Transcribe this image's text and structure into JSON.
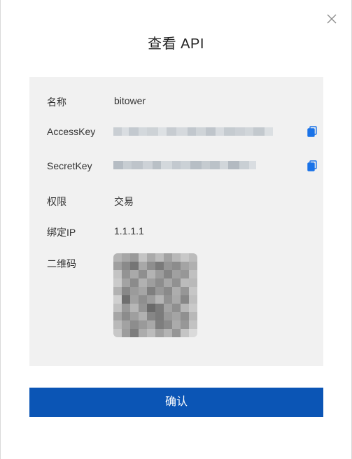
{
  "dialog": {
    "title": "查看 API",
    "close_icon": "close-icon"
  },
  "details": {
    "name_label": "名称",
    "name_value": "bitower",
    "access_key_label": "AccessKey",
    "access_key_value_masked": true,
    "secret_key_label": "SecretKey",
    "secret_key_value_masked": true,
    "permission_label": "权限",
    "permission_value": "交易",
    "bound_ip_label": "绑定IP",
    "bound_ip_value": "1.1.1.1",
    "qr_label": "二维码",
    "copy_icon": "copy-icon"
  },
  "footer": {
    "confirm_label": "确认"
  },
  "colors": {
    "accent": "#0b55b5",
    "panel_bg": "#f1f1f1",
    "copy_icon": "#1a73e8"
  }
}
